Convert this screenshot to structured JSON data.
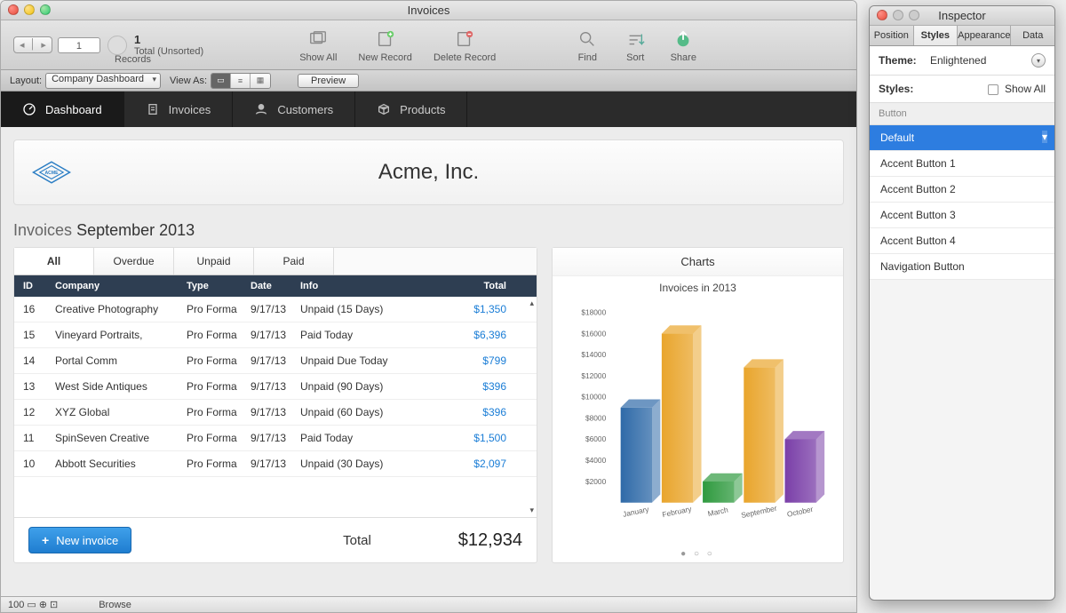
{
  "window": {
    "title": "Invoices"
  },
  "toolbar": {
    "record_current": "1",
    "record_count": "1",
    "record_sort": "Total (Unsorted)",
    "records_label": "Records",
    "showall": "Show All",
    "newrec": "New Record",
    "delrec": "Delete Record",
    "find": "Find",
    "sort": "Sort",
    "share": "Share"
  },
  "layoutbar": {
    "layout_label": "Layout:",
    "layout_value": "Company Dashboard",
    "viewas_label": "View As:",
    "preview": "Preview"
  },
  "nav": {
    "items": [
      {
        "label": "Dashboard"
      },
      {
        "label": "Invoices"
      },
      {
        "label": "Customers"
      },
      {
        "label": "Products"
      }
    ]
  },
  "company": {
    "name": "Acme, Inc."
  },
  "section": {
    "prefix": "Invoices",
    "period": "September 2013"
  },
  "invoice_tabs": [
    "All",
    "Overdue",
    "Unpaid",
    "Paid"
  ],
  "table": {
    "headers": {
      "id": "ID",
      "company": "Company",
      "type": "Type",
      "date": "Date",
      "info": "Info",
      "total": "Total"
    },
    "rows": [
      {
        "id": "16",
        "company": "Creative Photography",
        "type": "Pro Forma",
        "date": "9/17/13",
        "info": "Unpaid (15 Days)",
        "total": "$1,350"
      },
      {
        "id": "15",
        "company": "Vineyard Portraits,",
        "type": "Pro Forma",
        "date": "9/17/13",
        "info": "Paid Today",
        "total": "$6,396"
      },
      {
        "id": "14",
        "company": "Portal Comm",
        "type": "Pro Forma",
        "date": "9/17/13",
        "info": "Unpaid Due Today",
        "total": "$799"
      },
      {
        "id": "13",
        "company": "West Side Antiques",
        "type": "Pro Forma",
        "date": "9/17/13",
        "info": "Unpaid (90 Days)",
        "total": "$396"
      },
      {
        "id": "12",
        "company": "XYZ Global",
        "type": "Pro Forma",
        "date": "9/17/13",
        "info": "Unpaid (60 Days)",
        "total": "$396"
      },
      {
        "id": "11",
        "company": "SpinSeven Creative",
        "type": "Pro Forma",
        "date": "9/17/13",
        "info": "Paid Today",
        "total": "$1,500"
      },
      {
        "id": "10",
        "company": "Abbott Securities",
        "type": "Pro Forma",
        "date": "9/17/13",
        "info": "Unpaid (30 Days)",
        "total": "$2,097"
      }
    ],
    "footer": {
      "new_label": "New invoice",
      "total_label": "Total",
      "total_value": "$12,934"
    }
  },
  "chart_panel": {
    "header": "Charts",
    "title": "Invoices in 2013"
  },
  "chart_data": {
    "type": "bar",
    "categories": [
      "January",
      "February",
      "March",
      "September",
      "October"
    ],
    "values": [
      9000,
      16000,
      2000,
      12800,
      6000
    ],
    "colors": [
      "#2f6aa8",
      "#e9a52c",
      "#2f9a3f",
      "#e9a52c",
      "#7a3fa8"
    ],
    "ylim": [
      0,
      18000
    ],
    "yticks": [
      2000,
      4000,
      6000,
      8000,
      10000,
      12000,
      14000,
      16000,
      18000
    ],
    "title": "Invoices in 2013",
    "xlabel": "",
    "ylabel": ""
  },
  "statusbar": {
    "zoom": "100",
    "mode": "Browse"
  },
  "inspector": {
    "title": "Inspector",
    "tabs": [
      "Position",
      "Styles",
      "Appearance",
      "Data"
    ],
    "active_tab": "Styles",
    "theme_label": "Theme:",
    "theme_value": "Enlightened",
    "styles_label": "Styles:",
    "showall_label": "Show All",
    "category": "Button",
    "items": [
      "Default",
      "Accent Button 1",
      "Accent Button 2",
      "Accent Button 3",
      "Accent Button 4",
      "Navigation Button"
    ],
    "selected": "Default"
  }
}
